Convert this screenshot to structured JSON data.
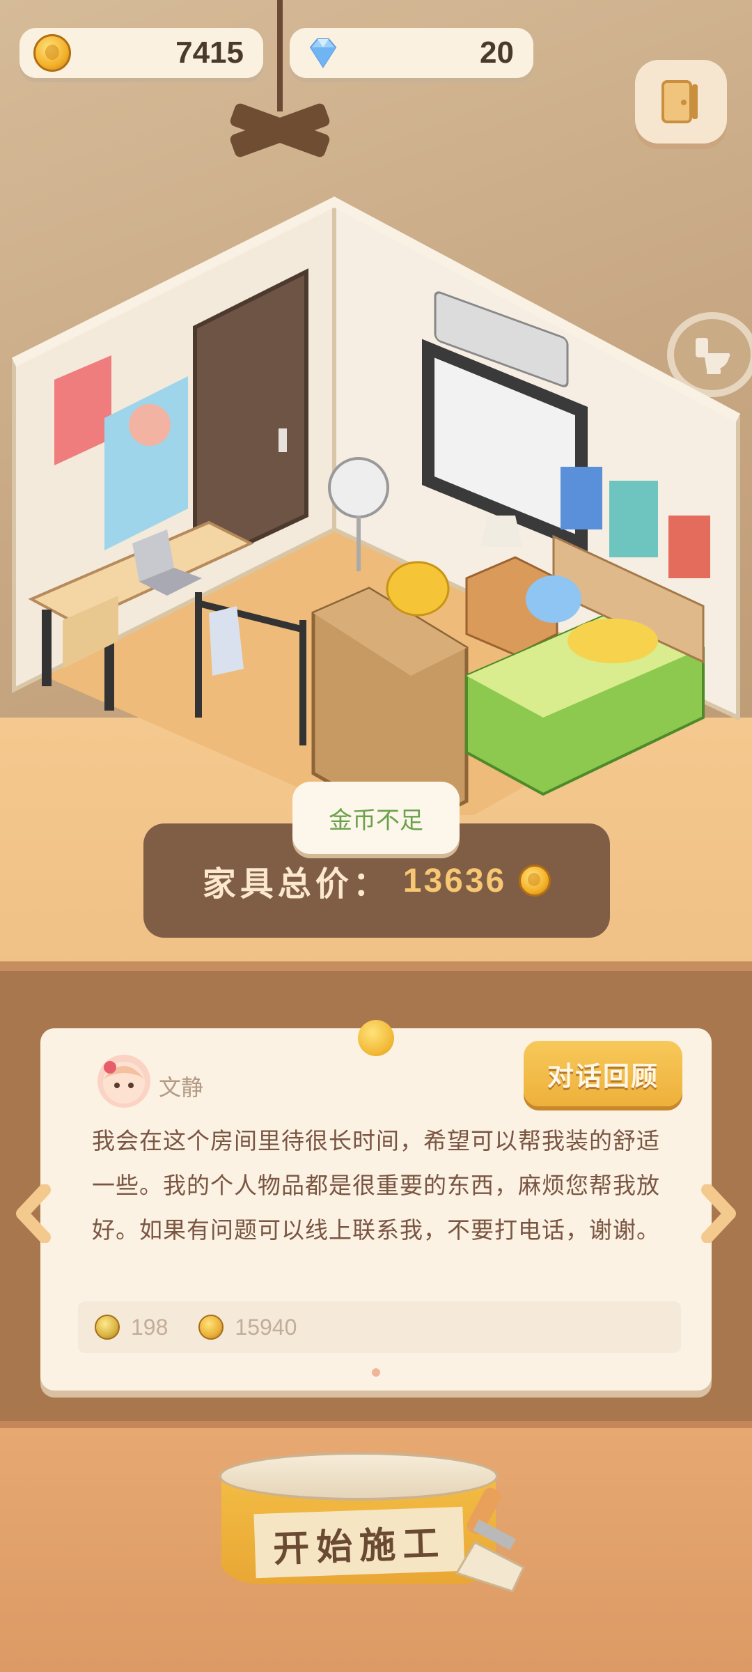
{
  "currency": {
    "coins": "7415",
    "gems": "20"
  },
  "scene": {
    "furniture_total_label": "家具总价：",
    "furniture_total_value": "13636",
    "toast": "金币不足"
  },
  "dialogue": {
    "npc_name": "文静",
    "review_button": "对话回顾",
    "text": "我会在这个房间里待很长时间，希望可以帮我装的舒适一些。我的个人物品都是很重要的东西，麻烦您帮我放好。如果有问题可以线上联系我，不要打电话，谢谢。",
    "rewards": [
      {
        "icon": "ribbon-medal-icon",
        "value": "198"
      },
      {
        "icon": "coin-icon",
        "value": "15940"
      }
    ]
  },
  "actions": {
    "start_button": "开始施工"
  },
  "colors": {
    "accent_gold": "#f2b936",
    "text_brown": "#7a5542",
    "toast_green": "#6aa24c"
  }
}
